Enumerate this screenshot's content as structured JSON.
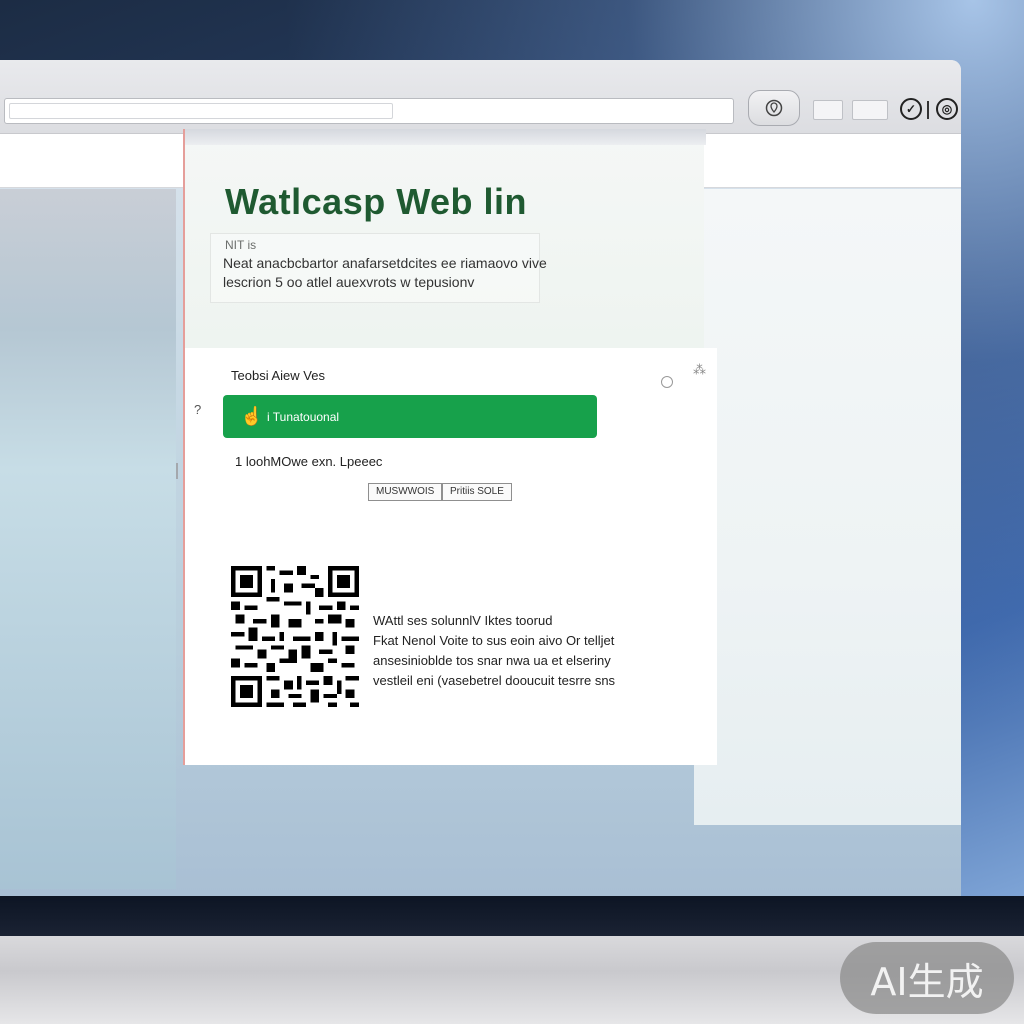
{
  "page": {
    "heading": "Watlcasp Web lin",
    "kicker": "NIT is",
    "description": [
      "Neat anacbcbartor anafarsetdcites ee riamaovo vive",
      "lescrion 5 oo atlel auexvrots w tepusionv"
    ]
  },
  "card": {
    "sub_label": "Teobsi Aiew Ves",
    "side_mark": "?",
    "primary_button": {
      "icon": "hand-pointer-icon",
      "label": "i Tunatouonal"
    },
    "link_text": "1 loohMOwe exn. Lpeeec",
    "chips": [
      "MUSWWOIS",
      "Pritiis SOLE"
    ],
    "info_lines": [
      "WAttl ses solunnlV Iktes toorud",
      "Fkat Nenol Voite to sus eoin aivo Or telljet",
      "ansesinioblde tos snar nwa ua et elseriny",
      "vestleil eni (vasebetrel dooucuit tesrre sns"
    ]
  },
  "toolbar": {
    "location_icon": "location-pin-icon",
    "check_icon": "check-circle-icon",
    "chrome_icon": "browser-logo-icon"
  },
  "watermark": "AI生成",
  "colors": {
    "accent_green": "#17a14b",
    "heading_green": "#1f5a31"
  }
}
